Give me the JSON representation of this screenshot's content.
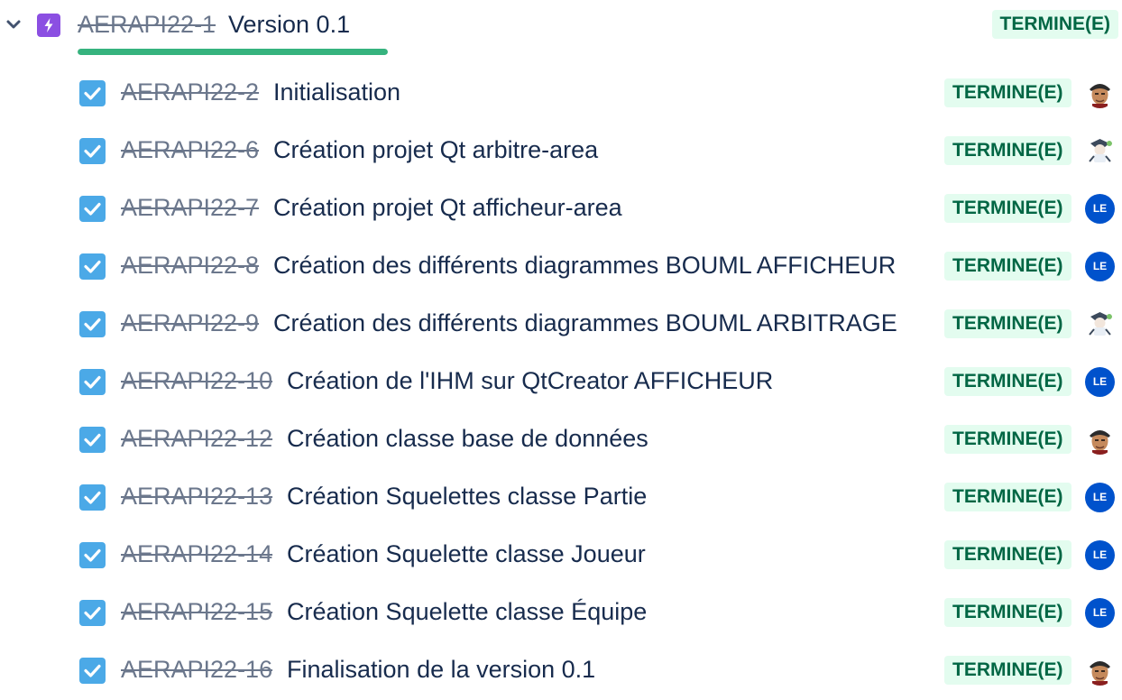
{
  "epic": {
    "key": "AERAPI22-1",
    "title": "Version 0.1",
    "status": "TERMINE(E)",
    "progress_fraction": 1.0,
    "icon": "epic-lightning-icon",
    "colors": {
      "epic": "#8b4fe2",
      "progress": "#36b37e",
      "done_bg": "#e3fcef",
      "done_text": "#006644"
    }
  },
  "issues": [
    {
      "key": "AERAPI22-2",
      "summary": "Initialisation",
      "status": "TERMINE(E)",
      "assignee": "avatar-person"
    },
    {
      "key": "AERAPI22-6",
      "summary": "Création projet Qt arbitre-area",
      "status": "TERMINE(E)",
      "assignee": "avatar-character"
    },
    {
      "key": "AERAPI22-7",
      "summary": "Création projet Qt afficheur-area",
      "status": "TERMINE(E)",
      "assignee": "LE"
    },
    {
      "key": "AERAPI22-8",
      "summary": "Création des différents diagrammes BOUML AFFICHEUR",
      "status": "TERMINE(E)",
      "assignee": "LE"
    },
    {
      "key": "AERAPI22-9",
      "summary": "Création des différents diagrammes BOUML ARBITRAGE",
      "status": "TERMINE(E)",
      "assignee": "avatar-character"
    },
    {
      "key": "AERAPI22-10",
      "summary": "Création de l'IHM sur QtCreator AFFICHEUR",
      "status": "TERMINE(E)",
      "assignee": "LE"
    },
    {
      "key": "AERAPI22-12",
      "summary": "Création classe base de données",
      "status": "TERMINE(E)",
      "assignee": "avatar-person"
    },
    {
      "key": "AERAPI22-13",
      "summary": "Création Squelettes classe Partie",
      "status": "TERMINE(E)",
      "assignee": "LE"
    },
    {
      "key": "AERAPI22-14",
      "summary": "Création Squelette classe Joueur",
      "status": "TERMINE(E)",
      "assignee": "LE"
    },
    {
      "key": "AERAPI22-15",
      "summary": "Création Squelette classe Équipe",
      "status": "TERMINE(E)",
      "assignee": "LE"
    },
    {
      "key": "AERAPI22-16",
      "summary": "Finalisation de la version 0.1",
      "status": "TERMINE(E)",
      "assignee": "avatar-person"
    }
  ]
}
